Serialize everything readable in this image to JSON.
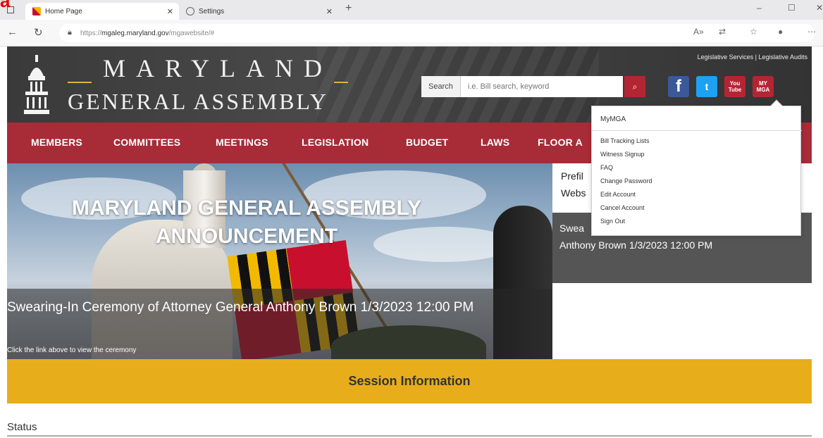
{
  "browser": {
    "tabs": [
      {
        "label": "Home Page"
      },
      {
        "label": "Settings"
      }
    ],
    "url_prefix": "https://",
    "url_domain": "mgaleg.maryland.gov",
    "url_path": "/mgawebsite/#",
    "controls": {
      "minimize": "–",
      "maximize": "☐",
      "close": "✕"
    }
  },
  "header": {
    "brand_line1": "MARYLAND",
    "brand_line2": "GENERAL ASSEMBLY",
    "top_links": "Legislative Services | Legislative Audits",
    "search_label": "Search",
    "search_placeholder": "i.e. Bill search, keyword",
    "social": {
      "facebook": "f",
      "twitter": "t",
      "youtube": "You Tube",
      "mymga": "MY MGA"
    }
  },
  "nav": [
    "MEMBERS",
    "COMMITTEES",
    "MEETINGS",
    "LEGISLATION",
    "BUDGET",
    "LAWS",
    "FLOOR A"
  ],
  "hero": {
    "title_line1": "MARYLAND GENERAL ASSEMBLY",
    "title_line2": "ANNOUNCEMENT",
    "headline": "Swearing-In Ceremony of Attorney General Anthony Brown 1/3/2023 12:00 PM",
    "subtext": "Click the link above to view the ceremony"
  },
  "right_panel": {
    "line1": "Prefil",
    "line2": "Webs",
    "dark_line1": "Swea",
    "dark_line2": "Anthony Brown 1/3/2023 12:00 PM"
  },
  "dropdown": {
    "title": "MyMGA",
    "items": [
      "Bill Tracking Lists",
      "Witness Signup",
      "FAQ",
      "Change Password",
      "Edit Account",
      "Cancel Account",
      "Sign Out"
    ]
  },
  "session": {
    "label": "Session Information"
  },
  "status": {
    "label": "Status"
  },
  "overlay": {
    "text": "a"
  }
}
